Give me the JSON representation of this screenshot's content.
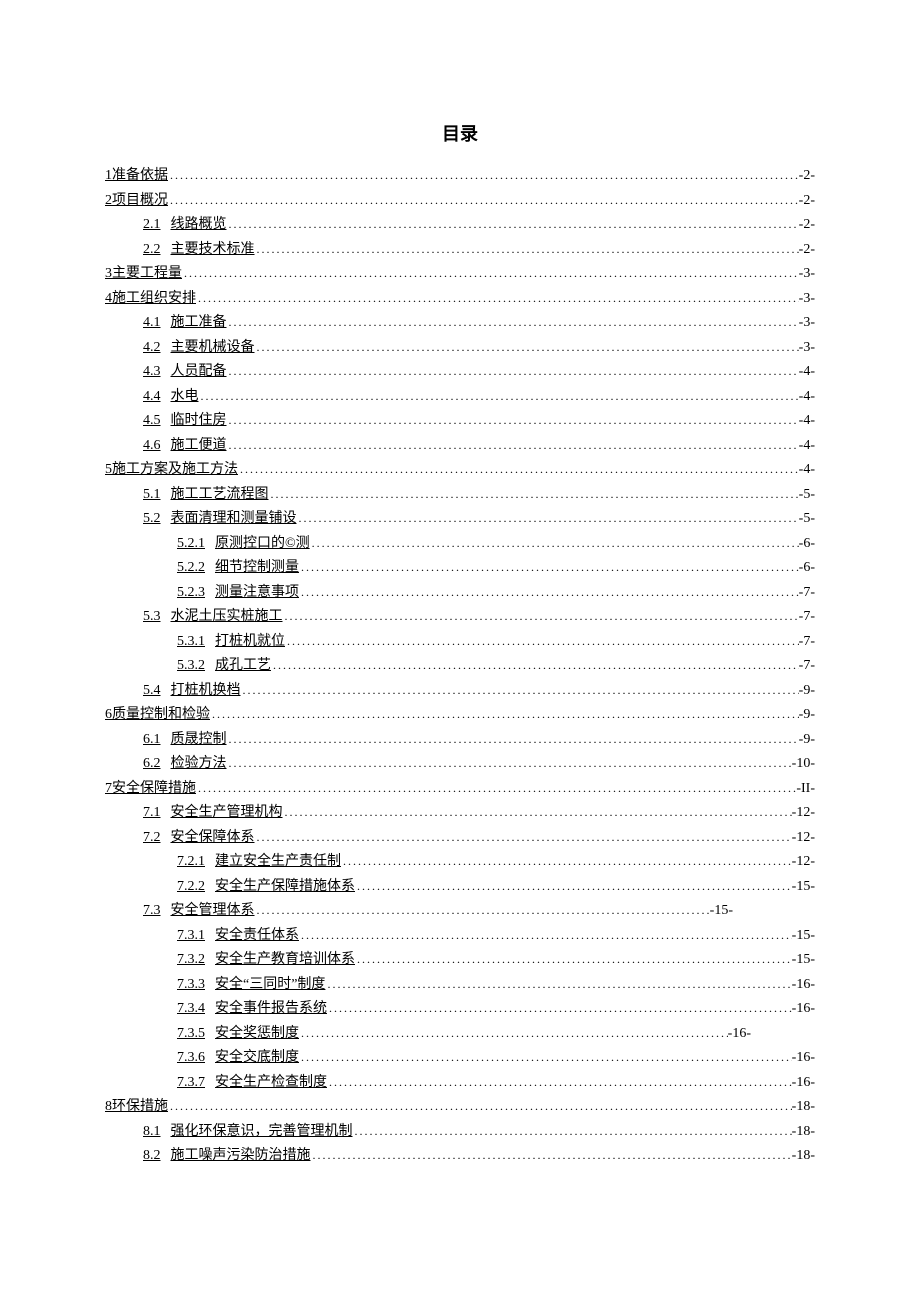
{
  "title": "目录",
  "entries": [
    {
      "indent": 0,
      "num": "1",
      "label": "准备依据",
      "gap": false,
      "page": "-2-"
    },
    {
      "indent": 0,
      "num": "2",
      "label": "项目概况",
      "gap": false,
      "page": "-2-"
    },
    {
      "indent": 1,
      "num": "2.1",
      "label": "线路概览",
      "gap": true,
      "page": "-2-"
    },
    {
      "indent": 1,
      "num": "2.2",
      "label": "主要技术标准",
      "gap": true,
      "page": "-2-"
    },
    {
      "indent": 0,
      "num": "3",
      "label": "主要工程量",
      "gap": false,
      "page": "-3-"
    },
    {
      "indent": 0,
      "num": "4",
      "label": "施工组织安排",
      "gap": false,
      "page": "-3-"
    },
    {
      "indent": 1,
      "num": "4.1",
      "label": "施工准备",
      "gap": true,
      "page": "-3-"
    },
    {
      "indent": 1,
      "num": "4.2",
      "label": "主要机械设备",
      "gap": true,
      "page": "-3-"
    },
    {
      "indent": 1,
      "num": "4.3",
      "label": "人员配备",
      "gap": true,
      "page": "-4-"
    },
    {
      "indent": 1,
      "num": "4.4",
      "label": "水电",
      "gap": true,
      "page": "-4-"
    },
    {
      "indent": 1,
      "num": "4.5",
      "label": "临时住房",
      "gap": true,
      "page": "-4-"
    },
    {
      "indent": 1,
      "num": "4.6",
      "label": "施工便道",
      "gap": true,
      "page": "-4-"
    },
    {
      "indent": 0,
      "num": "5",
      "label": "施工方案及施工方法",
      "gap": false,
      "page": "-4-"
    },
    {
      "indent": 1,
      "num": "5.1",
      "label": "施工工艺流程图",
      "gap": true,
      "page": "-5-"
    },
    {
      "indent": 1,
      "num": "5.2",
      "label": "表面清理和测量铺设",
      "gap": true,
      "page": "-5-"
    },
    {
      "indent": 2,
      "num": "5.2.1",
      "label": "原测控口的©测",
      "gap": true,
      "page": "-6-"
    },
    {
      "indent": 2,
      "num": "5.2.2",
      "label": "细节控制测量",
      "gap": true,
      "page": "-6-"
    },
    {
      "indent": 2,
      "num": "5.2.3",
      "label": "测量注意事项",
      "gap": true,
      "page": "-7-"
    },
    {
      "indent": 1,
      "num": "5.3",
      "label": "水泥土压实桩施工",
      "gap": true,
      "page": "-7-"
    },
    {
      "indent": 2,
      "num": "5.3.1",
      "label": "打桩机就位",
      "gap": true,
      "page": "-7-"
    },
    {
      "indent": 2,
      "num": "5.3.2",
      "label": "成孔工艺",
      "gap": true,
      "page": "-7-"
    },
    {
      "indent": 1,
      "num": "5.4",
      "label": "打桩机换档",
      "gap": true,
      "page": "-9-"
    },
    {
      "indent": 0,
      "num": "6",
      "label": "质量控制和检验",
      "gap": false,
      "page": "-9-"
    },
    {
      "indent": 1,
      "num": "6.1",
      "label": "质晟控制",
      "gap": true,
      "page": "-9-"
    },
    {
      "indent": 1,
      "num": "6.2",
      "label": "检验方法",
      "gap": true,
      "page": "-10-"
    },
    {
      "indent": 0,
      "num": "7",
      "label": "安全保障措施",
      "gap": false,
      "page": "-II-"
    },
    {
      "indent": 1,
      "num": "7.1",
      "label": "安全生产管理机构",
      "gap": true,
      "page": "-12-"
    },
    {
      "indent": 1,
      "num": "7.2",
      "label": "安全保障体系",
      "gap": true,
      "page": "-12-"
    },
    {
      "indent": 2,
      "num": "7.2.1",
      "label": "建立安全生产责任制",
      "gap": true,
      "page": "-12-"
    },
    {
      "indent": 2,
      "num": "7.2.2",
      "label": "安全生产保障措施体系",
      "gap": true,
      "page": "-15-"
    },
    {
      "indent": 1,
      "num": "7.3",
      "label": "安全管理体系",
      "gap": true,
      "page": "-15-",
      "rowClass": "short-7-3"
    },
    {
      "indent": 2,
      "num": "7.3.1",
      "label": "安全责任体系",
      "gap": true,
      "page": "-15-"
    },
    {
      "indent": 2,
      "num": "7.3.2",
      "label": "安全生产教育培训体系",
      "gap": true,
      "page": "-15-"
    },
    {
      "indent": 2,
      "num": "7.3.3",
      "label": "安全“三同时”制度",
      "gap": true,
      "page": "-16-"
    },
    {
      "indent": 2,
      "num": "7.3.4",
      "label": "安全事件报告系统",
      "gap": true,
      "page": "-16-"
    },
    {
      "indent": 2,
      "num": "7.3.5",
      "label": "安全奖惩制度",
      "gap": true,
      "page": "-16-",
      "rowClass": "short-7-3-5"
    },
    {
      "indent": 2,
      "num": "7.3.6",
      "label": "安全交底制度",
      "gap": true,
      "page": "-16-"
    },
    {
      "indent": 2,
      "num": "7.3.7",
      "label": "安全生产检查制度",
      "gap": true,
      "page": "-16-"
    },
    {
      "indent": 0,
      "num": "8",
      "label": "环保措施",
      "gap": false,
      "page": "-18-"
    },
    {
      "indent": 1,
      "num": "8.1",
      "label": "强化环保意识，完善管理机制",
      "gap": true,
      "page": "-18-"
    },
    {
      "indent": 1,
      "num": "8.2",
      "label": "施工噪声污染防治措施",
      "gap": true,
      "page": "-18-"
    }
  ]
}
